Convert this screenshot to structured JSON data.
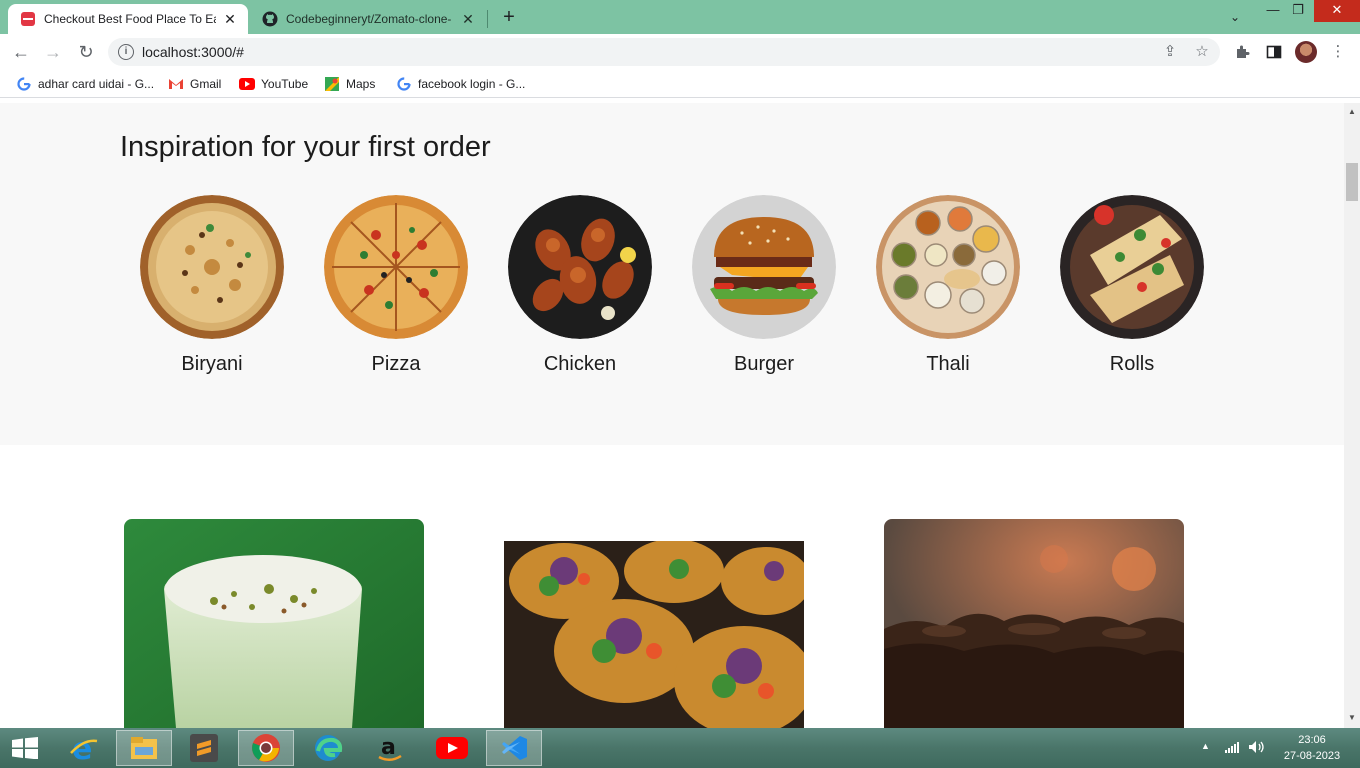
{
  "browser": {
    "tabs": [
      {
        "title": "Checkout Best Food Place To Eat",
        "active": true
      },
      {
        "title": "Codebeginneryt/Zomato-clone-",
        "active": false
      }
    ],
    "url": "localhost:3000/#",
    "bookmarks": [
      {
        "label": "adhar card uidai - G...",
        "icon": "google-icon"
      },
      {
        "label": "Gmail",
        "icon": "gmail-icon"
      },
      {
        "label": "YouTube",
        "icon": "youtube-icon"
      },
      {
        "label": "Maps",
        "icon": "maps-icon"
      },
      {
        "label": "facebook login - G...",
        "icon": "google-icon"
      }
    ]
  },
  "inspiration": {
    "title": "Inspiration for your first order",
    "items": [
      {
        "label": "Biryani"
      },
      {
        "label": "Pizza"
      },
      {
        "label": "Chicken"
      },
      {
        "label": "Burger"
      },
      {
        "label": "Thali"
      },
      {
        "label": "Rolls"
      }
    ]
  },
  "cards": [
    {
      "image": "lassi-drink"
    },
    {
      "image": "pani-puri"
    },
    {
      "image": "chocolate-cake"
    }
  ],
  "taskbar": {
    "time": "23:06",
    "date": "27-08-2023"
  },
  "colors": {
    "tabbar": "#7dc3a3",
    "zomato_red": "#e23744",
    "taskbar": "#4a7569"
  }
}
